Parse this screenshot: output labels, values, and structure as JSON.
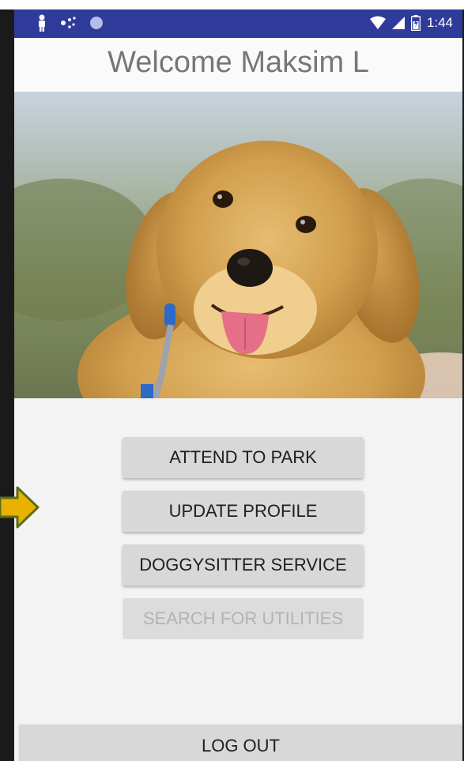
{
  "status_bar": {
    "time": "1:44",
    "left_icons": [
      "person-icon",
      "dots-icon",
      "circle-icon"
    ],
    "right_icons": [
      "wifi-icon",
      "signal-icon",
      "battery-icon"
    ],
    "background_color": "#2f3b9a"
  },
  "header": {
    "title": "Welcome Maksim L"
  },
  "hero_image": {
    "subject": "golden retriever puppy"
  },
  "menu": {
    "buttons": [
      {
        "label": "ATTEND TO PARK",
        "enabled": true
      },
      {
        "label": "UPDATE PROFILE",
        "enabled": true
      },
      {
        "label": "DOGGYSITTER SERVICE",
        "enabled": true
      },
      {
        "label": "SEARCH FOR UTILITIES",
        "enabled": false
      }
    ]
  },
  "footer": {
    "logout_label": "LOG OUT"
  },
  "annotation": {
    "arrow_color": "#e8b200",
    "pointing_to": "UPDATE PROFILE"
  }
}
